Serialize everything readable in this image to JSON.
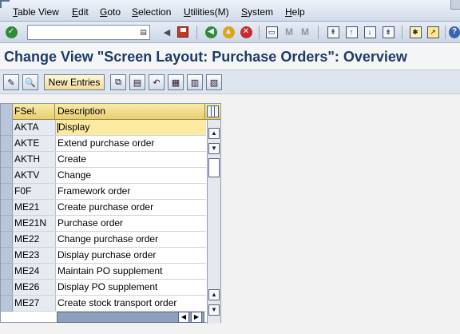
{
  "menu": {
    "items": [
      "Table View",
      "Edit",
      "Goto",
      "Selection",
      "Utilities(M)",
      "System",
      "Help"
    ]
  },
  "toolbar": {
    "command_value": "",
    "enter_icon": "check-icon",
    "save_icon": "save-icon",
    "back_icon": "back-icon",
    "exit_icon": "exit-icon",
    "cancel_icon": "cancel-icon"
  },
  "title": "Change View \"Screen Layout: Purchase Orders\": Overview",
  "app_toolbar": {
    "new_entries": "New Entries"
  },
  "table": {
    "headers": {
      "fsel": "FSel.",
      "description": "Description"
    },
    "rows": [
      {
        "fsel": "AKTA",
        "description": "Display",
        "active": true
      },
      {
        "fsel": "AKTE",
        "description": "Extend purchase order"
      },
      {
        "fsel": "AKTH",
        "description": "Create"
      },
      {
        "fsel": "AKTV",
        "description": "Change"
      },
      {
        "fsel": "F0F",
        "description": "Framework order"
      },
      {
        "fsel": "ME21",
        "description": "Create purchase order"
      },
      {
        "fsel": "ME21N",
        "description": "Purchase order"
      },
      {
        "fsel": "ME22",
        "description": "Change purchase order"
      },
      {
        "fsel": "ME23",
        "description": "Display purchase order"
      },
      {
        "fsel": "ME24",
        "description": "Maintain PO supplement"
      },
      {
        "fsel": "ME26",
        "description": "Display PO supplement"
      },
      {
        "fsel": "ME27",
        "description": "Create stock transport order"
      }
    ]
  },
  "colors": {
    "title": "#1f3b66",
    "header_bg": "#e9cf70",
    "active_row": "#fbeaa0"
  }
}
